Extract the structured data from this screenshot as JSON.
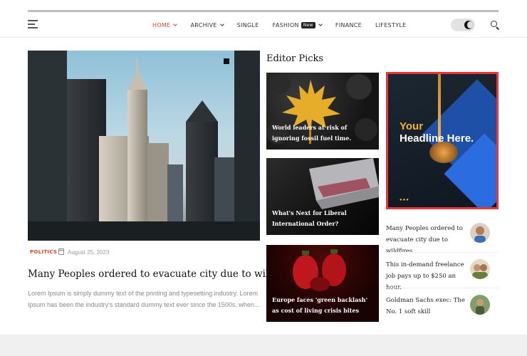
{
  "nav": {
    "items": [
      {
        "label": "HOME",
        "active": true,
        "dropdown": true
      },
      {
        "label": "ARCHIVE",
        "dropdown": true
      },
      {
        "label": "SINGLE"
      },
      {
        "label": "FASHION",
        "badge": "New",
        "dropdown": true
      },
      {
        "label": "FINANCE"
      },
      {
        "label": "LIFESTYLE"
      }
    ],
    "accent": "#e8402a"
  },
  "hero": {
    "category": "POLITICS",
    "date": "August 25, 2023",
    "title": "Many Peoples ordered to evacuate city due to wildfires",
    "excerpt": "Lorem Ipsum is simply dummy text of the printing and typesetting industry. Lorem Ipsum has been the industry's standard dummy text ever since the 1500s, when..."
  },
  "editor": {
    "title": "Editor Picks",
    "cards": [
      {
        "title": "World leaders at risk of ignoring fossil fuel time."
      },
      {
        "title": "What's Next for Liberal International Order?"
      },
      {
        "title": "Europe faces 'green backlash' as cost of living crisis bites"
      }
    ]
  },
  "ad": {
    "line1": "Your",
    "line2": "Headline Here.",
    "border_color": "#e53935"
  },
  "side": [
    {
      "title": "Many Peoples ordered to evacuate city due to wildfires"
    },
    {
      "title": "This in-demand freelance job pays up to $250 an hour."
    },
    {
      "title": "Goldman Sachs exec: The No. 1 soft skill"
    }
  ]
}
